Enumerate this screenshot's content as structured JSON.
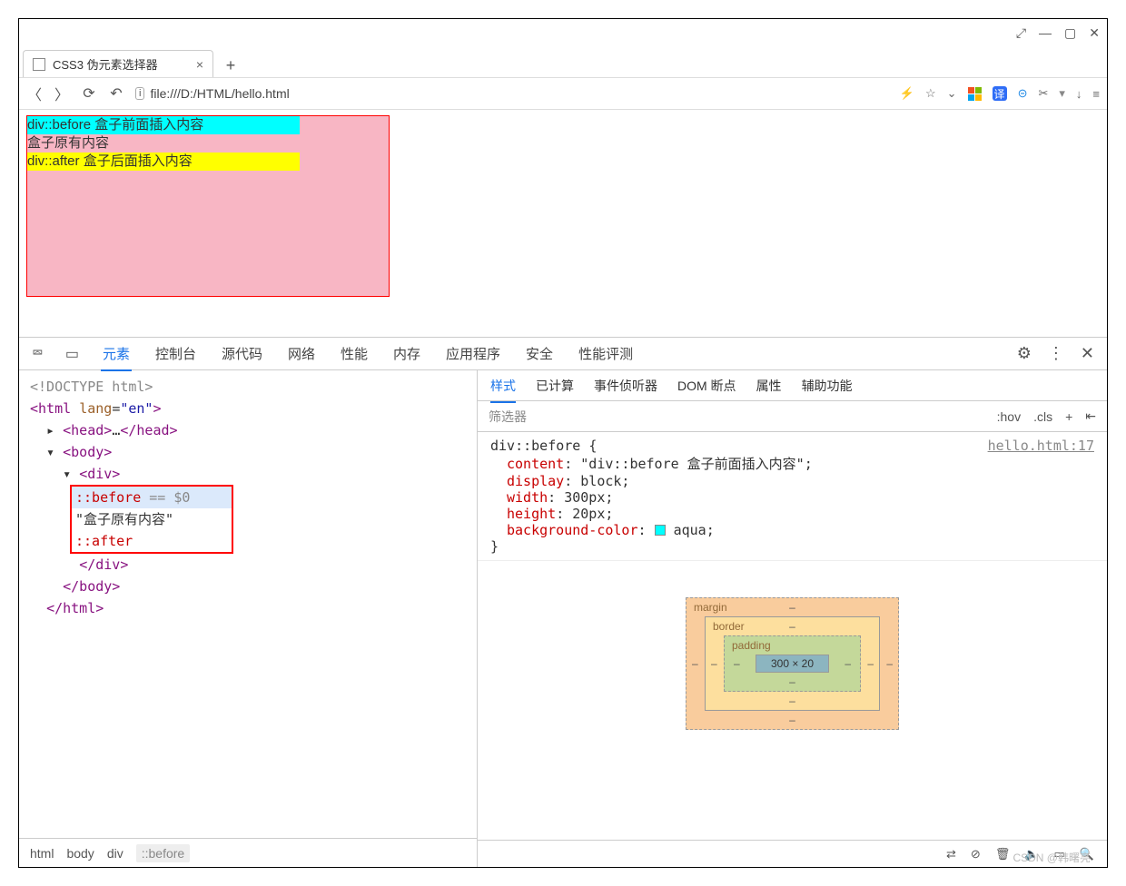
{
  "window": {
    "page_title": "CSS3 伪元素选择器"
  },
  "url": "file:///D:/HTML/hello.html",
  "demo": {
    "before_text": "div::before 盒子前面插入内容",
    "mid_text": "盒子原有内容",
    "after_text": "div::after 盒子后面插入内容"
  },
  "devtools": {
    "tabs": [
      "元素",
      "控制台",
      "源代码",
      "网络",
      "性能",
      "内存",
      "应用程序",
      "安全",
      "性能评测"
    ],
    "active_tab_index": 0,
    "dom": {
      "doctype": "<!DOCTYPE html>",
      "html_open": "<html lang=\"en\">",
      "head": "<head>…</head>",
      "body_open": "<body>",
      "div_open": "<div>",
      "before": "::before",
      "before_sel": " == $0",
      "text_node": "\"盒子原有内容\"",
      "after": "::after",
      "div_close": "</div>",
      "body_close": "</body>",
      "html_close": "</html>"
    },
    "breadcrumb": [
      "html",
      "body",
      "div",
      "::before"
    ],
    "styles_tabs": [
      "样式",
      "已计算",
      "事件侦听器",
      "DOM 断点",
      "属性",
      "辅助功能"
    ],
    "styles_active_index": 0,
    "filter_placeholder": "筛选器",
    "filter_buttons": {
      "hov": ":hov",
      "cls": ".cls",
      "plus": "+"
    },
    "source_link": "hello.html:17",
    "rule": {
      "selector": "div::before {",
      "props": [
        {
          "name": "content",
          "value": "\"div::before 盒子前面插入内容\";"
        },
        {
          "name": "display",
          "value": "block;"
        },
        {
          "name": "width",
          "value": "300px;"
        },
        {
          "name": "height",
          "value": "20px;"
        },
        {
          "name": "background-color",
          "value": "aqua;",
          "swatch": "#00ffff"
        }
      ],
      "close": "}"
    },
    "box_model": {
      "margin_label": "margin",
      "border_label": "border",
      "padding_label": "padding",
      "content": "300 × 20",
      "dash": "–"
    }
  },
  "watermark": "CSDN @韩曙亮"
}
